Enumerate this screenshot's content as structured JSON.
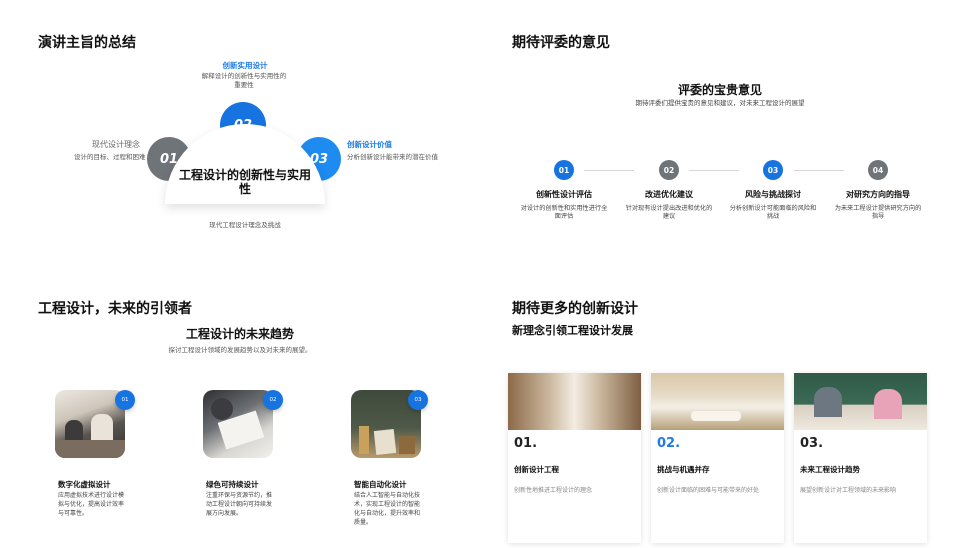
{
  "q1": {
    "title": "演讲主旨的总结",
    "center_text": "工程设计的创新性与实用性",
    "items": [
      {
        "num": "01",
        "title": "现代设计理念",
        "desc": "设计的目标、过程和困难"
      },
      {
        "num": "02",
        "title": "创新实用设计",
        "desc": "解释设计的创新性与实用性的重要性"
      },
      {
        "num": "03",
        "title": "创新设计价值",
        "desc": "分析创新设计能带来的潜在价值"
      }
    ],
    "bottom_text": "现代工程设计理念及挑战",
    "colors": {
      "blue": "#1673e0",
      "grey": "#6f7479"
    }
  },
  "q2": {
    "title": "期待评委的意见",
    "heading": "评委的宝贵意见",
    "subheading": "期待评委们提供宝贵的意见和建议，对未来工程设计的展望",
    "steps": [
      {
        "num": "01",
        "title": "创新性设计评估",
        "desc": "对设计的创新性和实用性进行全面评估",
        "color": "#1673e0"
      },
      {
        "num": "02",
        "title": "改进优化建议",
        "desc": "针对现有设计提出改进和优化的建议",
        "color": "#6f7479"
      },
      {
        "num": "03",
        "title": "风险与挑战探讨",
        "desc": "分析创新设计可能面临的风险和挑战",
        "color": "#1673e0"
      },
      {
        "num": "04",
        "title": "对研究方向的指导",
        "desc": "为未来工程设计提供研究方向的指导",
        "color": "#6f7479"
      }
    ]
  },
  "q3": {
    "title": "工程设计，未来的引领者",
    "heading": "工程设计的未来趋势",
    "subheading": "探讨工程设计领域的发展趋势以及对未来的展望。",
    "cards": [
      {
        "num": "01",
        "title": "数字化虚拟设计",
        "desc": "应用虚拟技术进行设计模拟与优化，提高设计效率与可靠性。"
      },
      {
        "num": "02",
        "title": "绿色可持续设计",
        "desc": "注重环保与资源节约，推动工程设计朝向可持续发展方向发展。"
      },
      {
        "num": "03",
        "title": "智能自动化设计",
        "desc": "结合人工智能与自动化技术，实现工程设计的智能化与自动化，提升效率和质量。"
      }
    ]
  },
  "q4": {
    "title": "期待更多的创新设计",
    "subtitle": "新理念引领工程设计发展",
    "cols": [
      {
        "num": "01.",
        "title": "创新设计工程",
        "desc": "创新性地推进工程设计的理念",
        "num_color": "#111111"
      },
      {
        "num": "02.",
        "title": "挑战与机遇并存",
        "desc": "创新设计面临的困难与可能带来的好处",
        "num_color": "#1e7be6"
      },
      {
        "num": "03.",
        "title": "未来工程设计趋势",
        "desc": "展望创新设计对工程领域的未来影响",
        "num_color": "#111111"
      }
    ]
  }
}
